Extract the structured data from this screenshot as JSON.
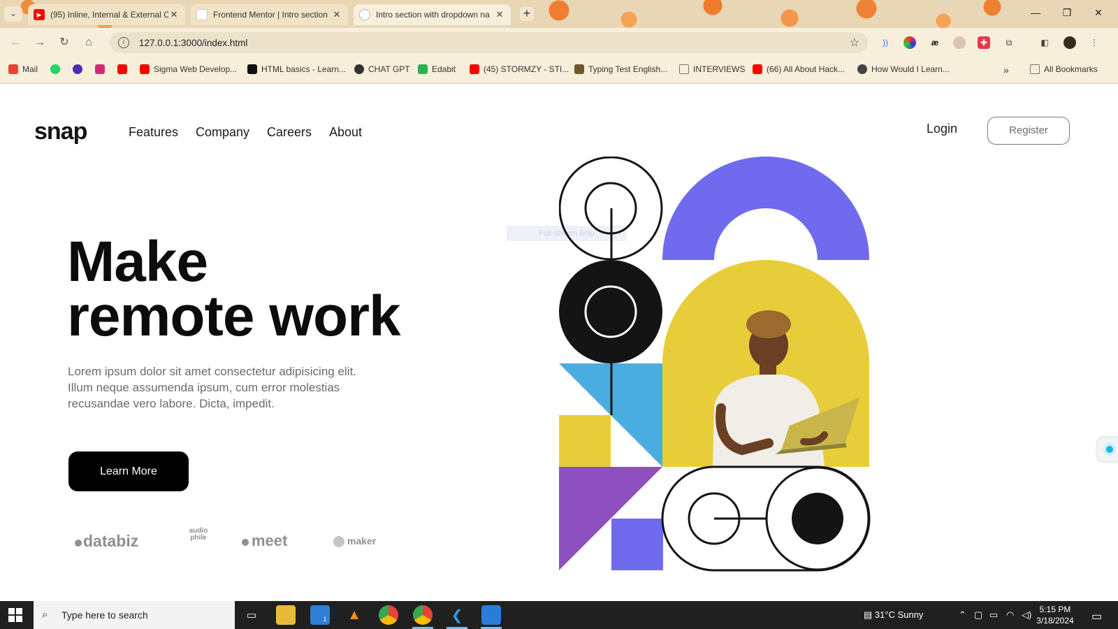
{
  "browser": {
    "tabs": [
      {
        "title": "(95) Inline, Internal & External C",
        "favicon": "youtube-icon",
        "color": "#ff0000"
      },
      {
        "title": "Frontend Mentor | Intro section",
        "favicon": "frontend-mentor-icon",
        "color": "#ffffff"
      },
      {
        "title": "Intro section with dropdown na",
        "favicon": "globe-icon",
        "color": "#ffffff"
      }
    ],
    "url": "127.0.0.1:3000/index.html",
    "bookmarks": [
      {
        "label": "Mail",
        "icon": "gmail-icon",
        "color": "#ea4335"
      },
      {
        "label": "",
        "icon": "whatsapp-icon",
        "color": "#25d366"
      },
      {
        "label": "",
        "icon": "calendar-icon",
        "color": "#4a2fb0"
      },
      {
        "label": "",
        "icon": "instagram-icon",
        "color": "#d62976"
      },
      {
        "label": "",
        "icon": "youtube-icon",
        "color": "#ff0000"
      },
      {
        "label": "Sigma Web Develop...",
        "icon": "youtube-icon",
        "color": "#ff0000"
      },
      {
        "label": "HTML basics - Learn...",
        "icon": "mdn-icon",
        "color": "#111111"
      },
      {
        "label": "CHAT GPT",
        "icon": "openai-icon",
        "color": "#333333"
      },
      {
        "label": "Edabit",
        "icon": "edabit-icon",
        "color": "#2bb24c"
      },
      {
        "label": "(45) STORMZY - STI...",
        "icon": "youtube-icon",
        "color": "#ff0000"
      },
      {
        "label": "Typing Test English...",
        "icon": "typing-icon",
        "color": "#6b5a2a"
      },
      {
        "label": "INTERVIEWS",
        "icon": "folder-icon",
        "color": "#777777"
      },
      {
        "label": "(66) All About Hack...",
        "icon": "youtube-icon",
        "color": "#ff0000"
      },
      {
        "label": "How Would I Learn...",
        "icon": "globe-icon",
        "color": "#444444"
      }
    ],
    "all_bookmarks": "All Bookmarks"
  },
  "page": {
    "logo": "snap",
    "nav": [
      "Features",
      "Company",
      "Careers",
      "About"
    ],
    "login": "Login",
    "register": "Register",
    "hero": {
      "title_line1": "Make",
      "title_line2": "remote work",
      "text": "Lorem ipsum dolor sit amet consectetur adipisicing elit. Illum neque assumenda ipsum, cum error molestias recusandae vero labore. Dicta, impedit.",
      "cta": "Learn More"
    },
    "brands": [
      "databiz",
      "audio phile",
      "meet",
      "maker"
    ],
    "snip_overlay": "Full-screen Snip",
    "colors": {
      "purple": "#6f6aee",
      "yellow": "#e8cd3b",
      "blue": "#49ade0",
      "violet": "#8e4fbf",
      "black": "#141414"
    }
  },
  "taskbar": {
    "search_placeholder": "Type here to search",
    "weather": "31°C  Sunny",
    "time": "5:15 PM",
    "date": "3/18/2024",
    "mail_badge": "1"
  }
}
